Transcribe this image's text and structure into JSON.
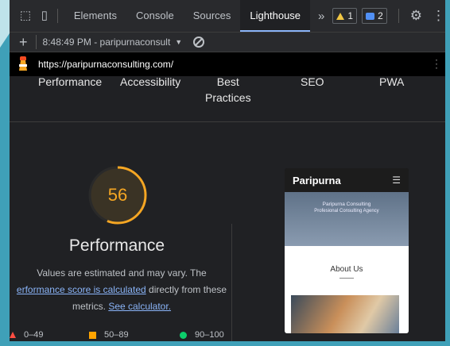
{
  "devtools": {
    "tabs": [
      "Elements",
      "Console",
      "Sources",
      "Lighthouse"
    ],
    "active_tab": "Lighthouse",
    "warnings_count": "1",
    "messages_count": "2",
    "report_selector": "8:48:49 PM - paripurnaconsult",
    "url": "https://paripurnaconsulting.com/"
  },
  "categories": [
    {
      "label": "Performance"
    },
    {
      "label": "Accessibility"
    },
    {
      "label": "Best\nPractices"
    },
    {
      "label": "SEO"
    },
    {
      "label": "PWA"
    }
  ],
  "performance": {
    "score": "56",
    "score_value": 56,
    "title": "Performance",
    "desc_part1": "Values are estimated and may vary. The",
    "desc_link": "erformance score is calculated",
    "desc_part2": "directly from these",
    "desc_part3": "metrics.",
    "calc_link": "See calculator.",
    "gauge_color": "#f5a623"
  },
  "legend": [
    {
      "label": "0–49",
      "color": "#ff4e42"
    },
    {
      "label": "50–89",
      "color": "#ffa400"
    },
    {
      "label": "90–100",
      "color": "#0cce6b"
    }
  ],
  "preview": {
    "brand": "Paripurna",
    "hero_line1": "Paripurna Consulting",
    "hero_line2": "Profesional Consulting Agency",
    "about": "About Us"
  }
}
